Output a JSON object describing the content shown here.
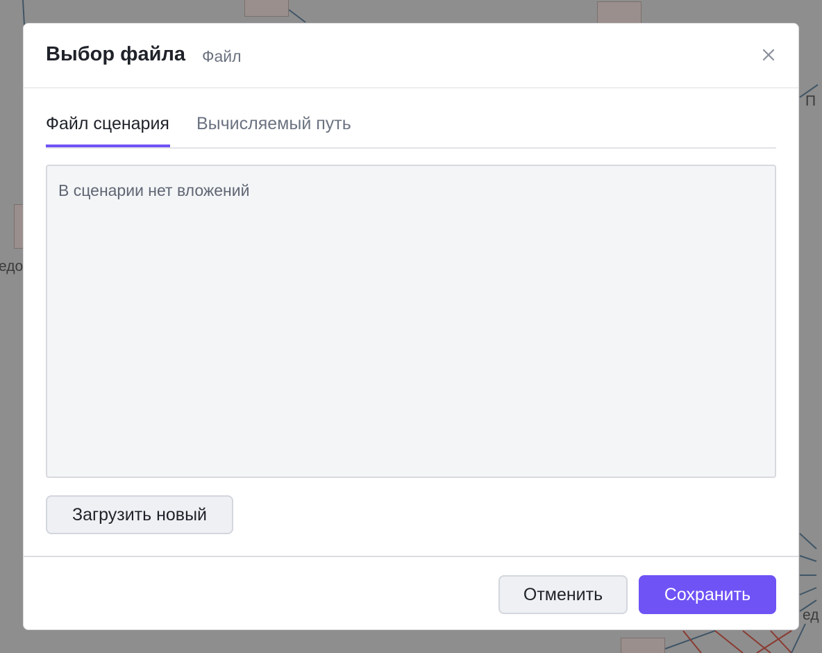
{
  "background": {
    "label_left": "едо",
    "label_right_top": "П",
    "label_right_bottom": "ед"
  },
  "modal": {
    "title": "Выбор файла",
    "subtitle": "Файл",
    "tabs": [
      {
        "label": "Файл сценария",
        "active": true
      },
      {
        "label": "Вычисляемый путь",
        "active": false
      }
    ],
    "attachments": {
      "empty_message": "В сценарии нет вложений"
    },
    "upload_label": "Загрузить новый",
    "footer": {
      "cancel_label": "Отменить",
      "save_label": "Сохранить"
    }
  },
  "colors": {
    "accent": "#7053f5",
    "overlay": "#8e8e8e",
    "panel_bg": "#f4f5f7"
  },
  "icons": {
    "close": "close-icon"
  }
}
